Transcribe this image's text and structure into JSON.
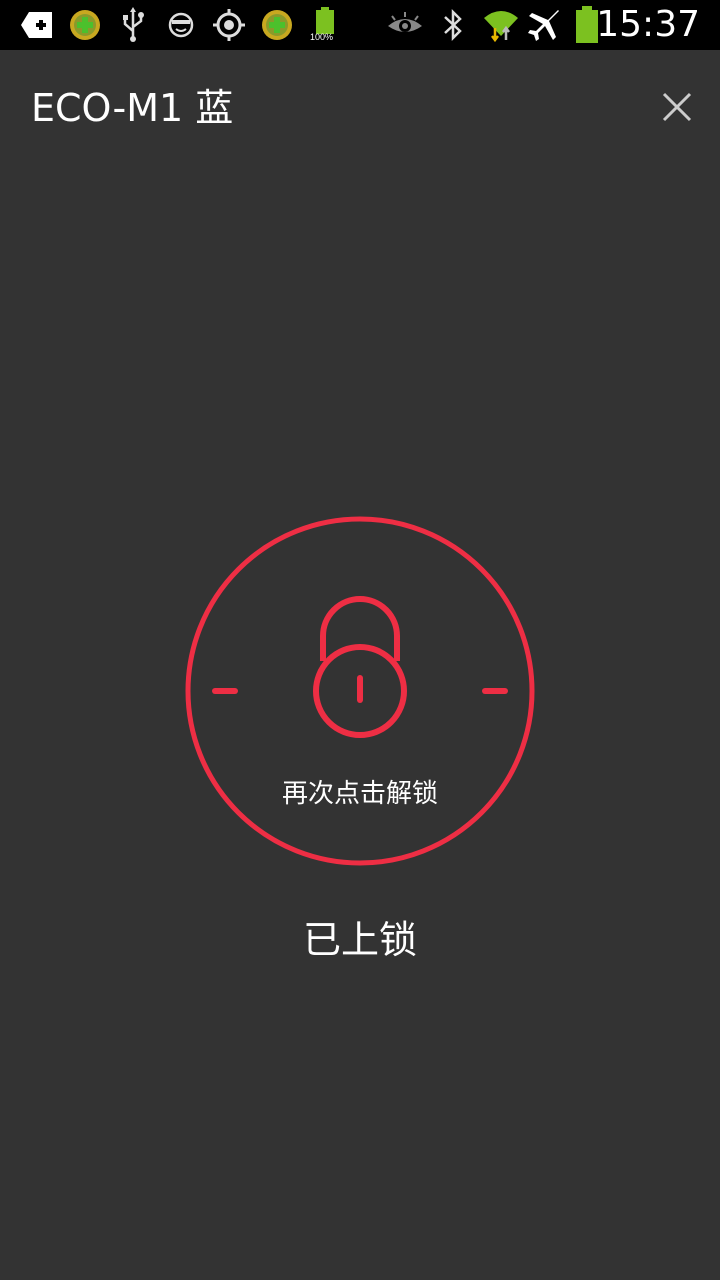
{
  "status_bar": {
    "time": "15:37",
    "battery_small_label": "100%",
    "left_icons": [
      "add-icon",
      "app-plus-icon",
      "usb-icon",
      "face-icon",
      "gps-icon",
      "app-plus-icon",
      "battery-small-icon"
    ],
    "right_icons": [
      "eye-icon",
      "bluetooth-icon",
      "wifi-icon",
      "airplane-icon",
      "battery-icon"
    ]
  },
  "header": {
    "title": "ECO-M1 蓝",
    "close_icon": "close-icon"
  },
  "lock": {
    "hint": "再次点击解锁",
    "state": "已上锁",
    "icon": "padlock-icon",
    "accent_color": "#EE2E44"
  }
}
